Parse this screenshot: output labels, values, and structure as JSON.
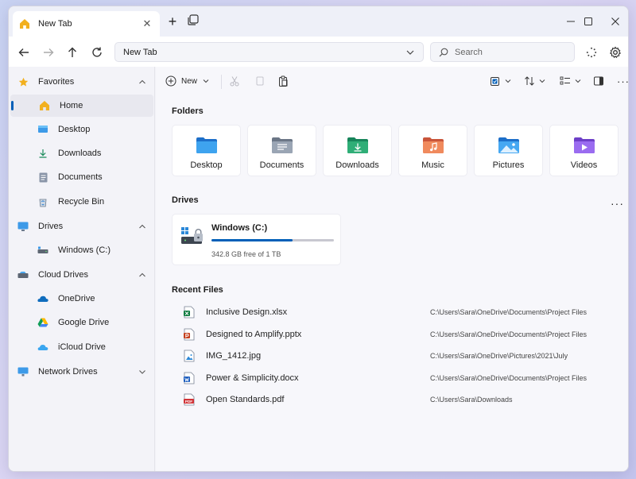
{
  "tab": {
    "title": "New Tab"
  },
  "address": {
    "value": "New Tab"
  },
  "search": {
    "placeholder": "Search"
  },
  "sidebar": {
    "favorites": {
      "label": "Favorites",
      "items": [
        {
          "label": "Home",
          "icon": "home-icon"
        },
        {
          "label": "Desktop",
          "icon": "desktop-icon"
        },
        {
          "label": "Downloads",
          "icon": "download-icon"
        },
        {
          "label": "Documents",
          "icon": "document-icon"
        },
        {
          "label": "Recycle Bin",
          "icon": "recycle-bin-icon"
        }
      ]
    },
    "drives": {
      "label": "Drives",
      "items": [
        {
          "label": "Windows (C:)",
          "icon": "drive-icon"
        }
      ]
    },
    "cloud": {
      "label": "Cloud Drives",
      "items": [
        {
          "label": "OneDrive",
          "icon": "onedrive-icon"
        },
        {
          "label": "Google Drive",
          "icon": "google-drive-icon"
        },
        {
          "label": "iCloud Drive",
          "icon": "icloud-icon"
        }
      ]
    },
    "network": {
      "label": "Network Drives"
    }
  },
  "toolbar": {
    "new_label": "New"
  },
  "sections": {
    "folders": "Folders",
    "drives": "Drives",
    "recent": "Recent Files"
  },
  "folders": [
    {
      "label": "Desktop",
      "icon": "desktop-folder-icon"
    },
    {
      "label": "Documents",
      "icon": "documents-folder-icon"
    },
    {
      "label": "Downloads",
      "icon": "downloads-folder-icon"
    },
    {
      "label": "Music",
      "icon": "music-folder-icon"
    },
    {
      "label": "Pictures",
      "icon": "pictures-folder-icon"
    },
    {
      "label": "Videos",
      "icon": "videos-folder-icon"
    }
  ],
  "drive": {
    "name": "Windows (C:)",
    "free_text": "342.8 GB free of 1 TB",
    "used_fraction": 0.66
  },
  "recent_files": [
    {
      "name": "Inclusive Design.xlsx",
      "path": "C:\\Users\\Sara\\OneDrive\\Documents\\Project Files",
      "icon": "excel-icon"
    },
    {
      "name": "Designed to Amplify.pptx",
      "path": "C:\\Users\\Sara\\OneDrive\\Documents\\Project Files",
      "icon": "powerpoint-icon"
    },
    {
      "name": "IMG_1412.jpg",
      "path": "C:\\Users\\Sara\\OneDrive\\Pictures\\2021\\July",
      "icon": "image-file-icon"
    },
    {
      "name": "Power & Simplicity.docx",
      "path": "C:\\Users\\Sara\\OneDrive\\Documents\\Project Files",
      "icon": "word-icon"
    },
    {
      "name": "Open Standards.pdf",
      "path": "C:\\Users\\Sara\\Downloads",
      "icon": "pdf-icon",
      "badge": "PDF"
    }
  ],
  "colors": {
    "accent": "#005fb8",
    "home_icon": "#f2b01e"
  }
}
